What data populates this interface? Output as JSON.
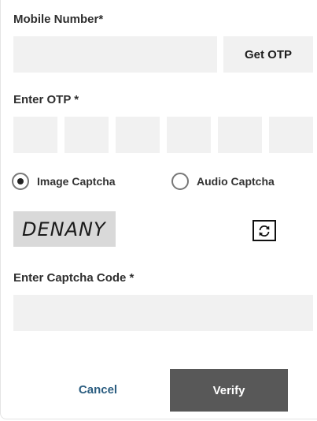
{
  "mobile": {
    "label": "Mobile Number*",
    "value": "",
    "placeholder": "",
    "get_otp_label": "Get OTP"
  },
  "otp": {
    "label": "Enter OTP *",
    "digits": [
      "",
      "",
      "",
      "",
      "",
      ""
    ]
  },
  "captcha_type": {
    "options": [
      {
        "label": "Image Captcha",
        "selected": true
      },
      {
        "label": "Audio Captcha",
        "selected": false
      }
    ]
  },
  "captcha": {
    "text": "DENANY",
    "refresh_icon": "refresh-icon"
  },
  "captcha_code": {
    "label": "Enter Captcha Code *",
    "value": "",
    "placeholder": ""
  },
  "actions": {
    "cancel_label": "Cancel",
    "verify_label": "Verify"
  },
  "colors": {
    "field_bg": "#f1f1f1",
    "verify_bg": "#585858",
    "cancel_text": "#2b5d80",
    "captcha_bg": "#d9d9d9"
  }
}
